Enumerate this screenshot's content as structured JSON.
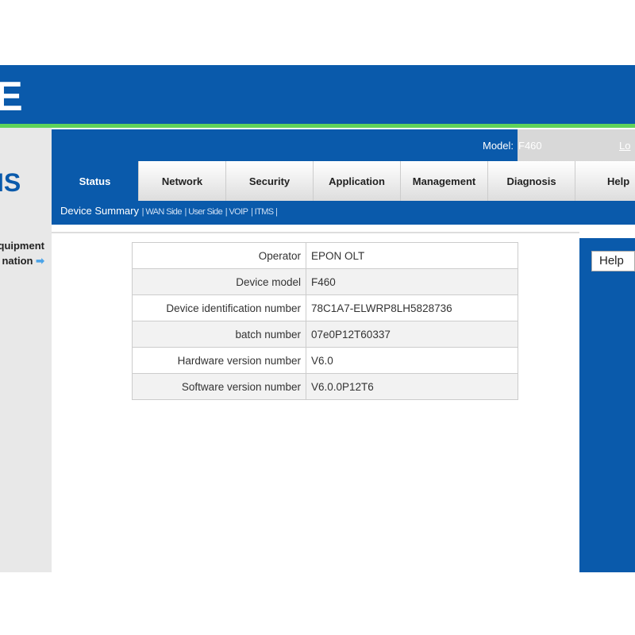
{
  "header": {
    "logo": "E",
    "brand": "IS",
    "model_label": "Model:",
    "model_value": "F460",
    "logout": "Lo"
  },
  "tabs": [
    "Status",
    "Network",
    "Security",
    "Application",
    "Management",
    "Diagnosis",
    "Help"
  ],
  "subnav": {
    "active": "Device Summary",
    "items": [
      "WAN Side",
      "User Side",
      "VOIP",
      "ITMS"
    ]
  },
  "sidebar": {
    "line1": "quipment",
    "line2": "nation"
  },
  "table": [
    {
      "key": "Operator",
      "value": "EPON OLT"
    },
    {
      "key": "Device model",
      "value": "F460"
    },
    {
      "key": "Device identification number",
      "value": "78C1A7-ELWRP8LH5828736"
    },
    {
      "key": "batch number",
      "value": "07e0P12T60337"
    },
    {
      "key": "Hardware version number",
      "value": "V6.0"
    },
    {
      "key": "Software version number",
      "value": "V6.0.0P12T6"
    }
  ],
  "help_button": "Help",
  "colors": {
    "brand_blue": "#0a5aab",
    "accent_green": "#5fd35a"
  }
}
